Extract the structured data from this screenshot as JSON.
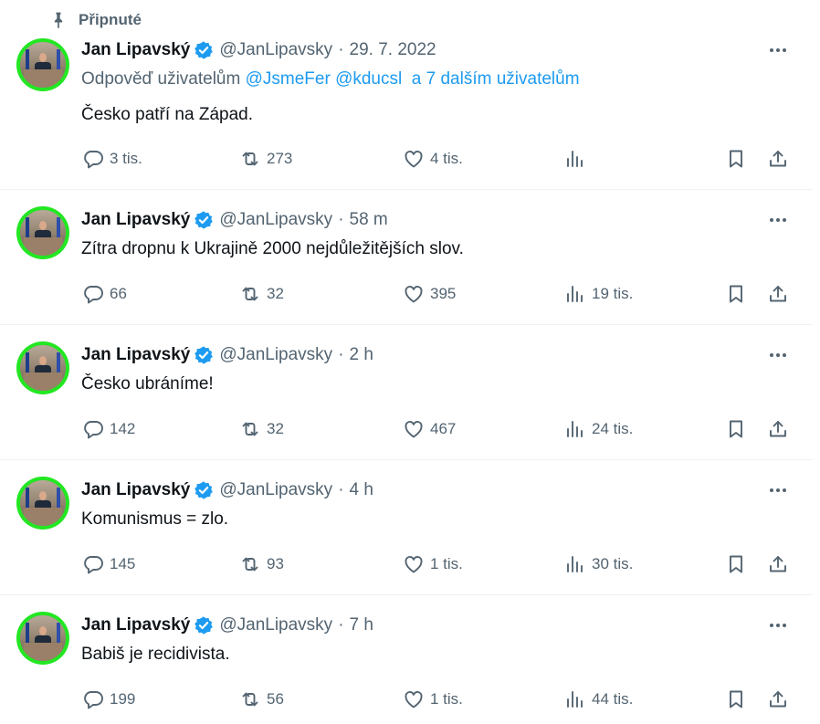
{
  "pinned_label": "Připnuté",
  "colors": {
    "accent": "#1d9bf0",
    "muted": "#536471",
    "avatar_ring": "#22e722"
  },
  "icons": [
    "pin-icon",
    "verified-badge-icon",
    "more-icon",
    "reply-icon",
    "retweet-icon",
    "like-icon",
    "views-icon",
    "bookmark-icon",
    "share-icon"
  ],
  "tweets": [
    {
      "name": "Jan Lipavský",
      "handle": "@JanLipavsky",
      "dot": "·",
      "time": "29. 7. 2022",
      "reply_prefix": "Odpověď uživatelům",
      "mention1": "@JsmeFer",
      "mention2": "@kducsl",
      "mention_more": "a 7 dalším uživatelům",
      "text": "Česko patří na Západ.",
      "replies": "3 tis.",
      "retweets": "273",
      "likes": "4 tis.",
      "views": ""
    },
    {
      "name": "Jan Lipavský",
      "handle": "@JanLipavsky",
      "dot": "·",
      "time": "58 m",
      "text": "Zítra dropnu k Ukrajině 2000 nejdůležitějších slov.",
      "replies": "66",
      "retweets": "32",
      "likes": "395",
      "views": "19 tis."
    },
    {
      "name": "Jan Lipavský",
      "handle": "@JanLipavsky",
      "dot": "·",
      "time": "2 h",
      "text": "Česko ubráníme!",
      "replies": "142",
      "retweets": "32",
      "likes": "467",
      "views": "24 tis."
    },
    {
      "name": "Jan Lipavský",
      "handle": "@JanLipavsky",
      "dot": "·",
      "time": "4 h",
      "text": "Komunismus = zlo.",
      "replies": "145",
      "retweets": "93",
      "likes": "1 tis.",
      "views": "30 tis."
    },
    {
      "name": "Jan Lipavský",
      "handle": "@JanLipavsky",
      "dot": "·",
      "time": "7 h",
      "text": "Babiš je recidivista.",
      "replies": "199",
      "retweets": "56",
      "likes": "1 tis.",
      "views": "44 tis."
    }
  ]
}
